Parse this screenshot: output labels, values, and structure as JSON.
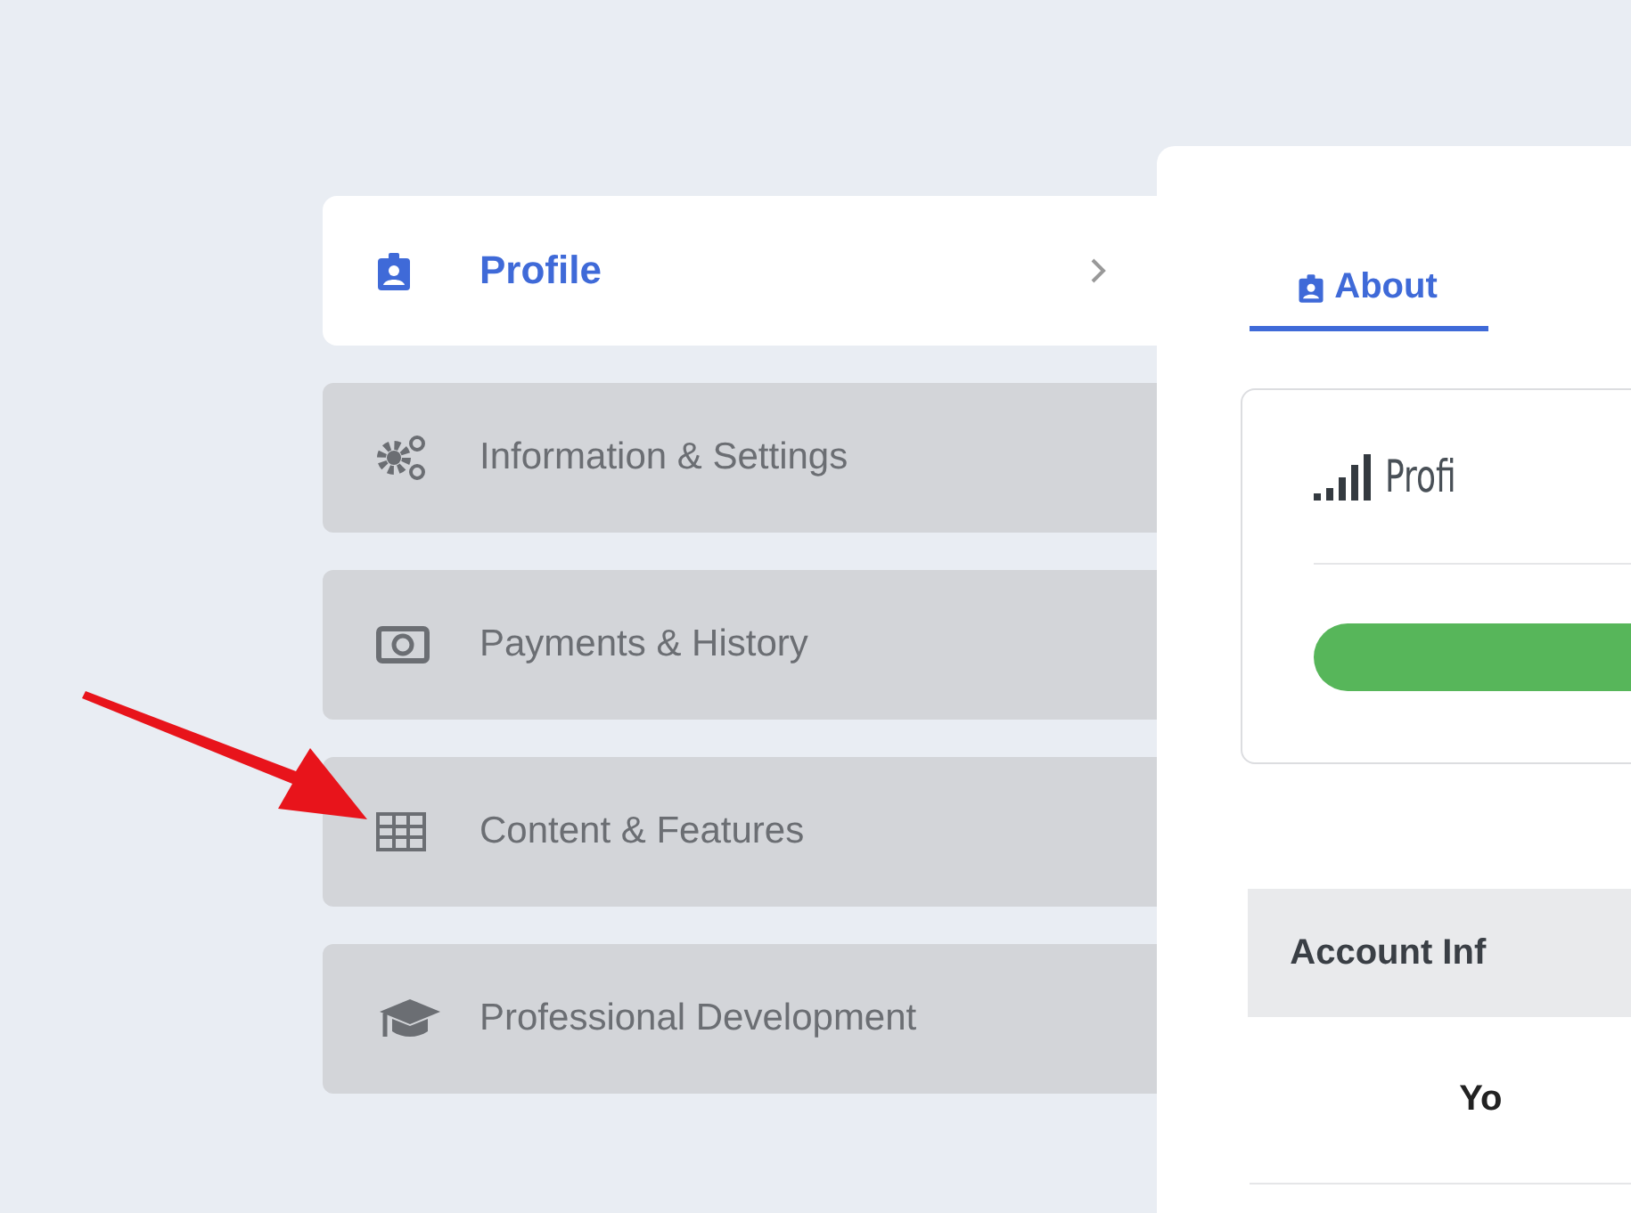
{
  "sidebar": {
    "items": [
      {
        "label": "Profile",
        "selected": true
      },
      {
        "label": "Information & Settings",
        "selected": false
      },
      {
        "label": "Payments & History",
        "selected": false
      },
      {
        "label": "Content & Features",
        "selected": false
      },
      {
        "label": "Professional Development",
        "selected": false
      }
    ]
  },
  "panel": {
    "tabs": [
      {
        "label": "About",
        "selected": true
      }
    ],
    "profile_card": {
      "title": "Profi"
    },
    "account_header": "Account Inf",
    "row_label": "Yo"
  }
}
